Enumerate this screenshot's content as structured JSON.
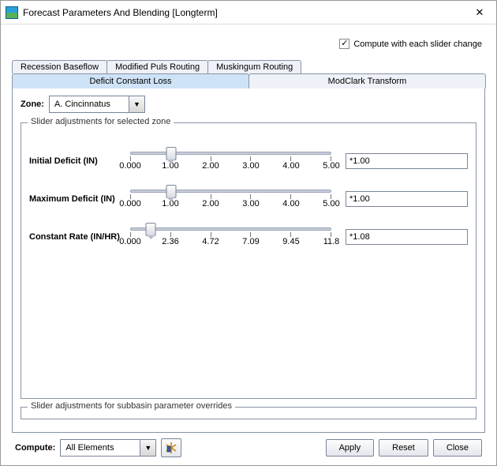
{
  "window": {
    "title": "Forecast Parameters And Blending [Longterm]"
  },
  "topCheckbox": {
    "label": "Compute with each slider change",
    "checked": "✓"
  },
  "tabsRow1": [
    "Recession Baseflow",
    "Modified Puls Routing",
    "Muskingum Routing"
  ],
  "tabsRow2": [
    "Deficit Constant Loss",
    "ModClark Transform"
  ],
  "zone": {
    "label": "Zone:",
    "value": "A. Cincinnatus"
  },
  "zoneFieldset": {
    "legend": "Slider adjustments for selected zone"
  },
  "sliders": [
    {
      "label": "Initial Deficit (IN)",
      "ticks": [
        "0.000",
        "1.00",
        "2.00",
        "3.00",
        "4.00",
        "5.00"
      ],
      "value": "*1.00",
      "pos": 20
    },
    {
      "label": "Maximum Deficit (IN)",
      "ticks": [
        "0.000",
        "1.00",
        "2.00",
        "3.00",
        "4.00",
        "5.00"
      ],
      "value": "*1.00",
      "pos": 20
    },
    {
      "label": "Constant Rate (IN/HR)",
      "ticks": [
        "0.000",
        "2.36",
        "4.72",
        "7.09",
        "9.45",
        "11.8"
      ],
      "value": "*1.08",
      "pos": 10
    }
  ],
  "overridesFieldset": {
    "legend": "Slider adjustments for subbasin parameter overrides"
  },
  "bottom": {
    "computeLabel": "Compute:",
    "computeValue": "All Elements",
    "apply": "Apply",
    "reset": "Reset",
    "close": "Close"
  }
}
